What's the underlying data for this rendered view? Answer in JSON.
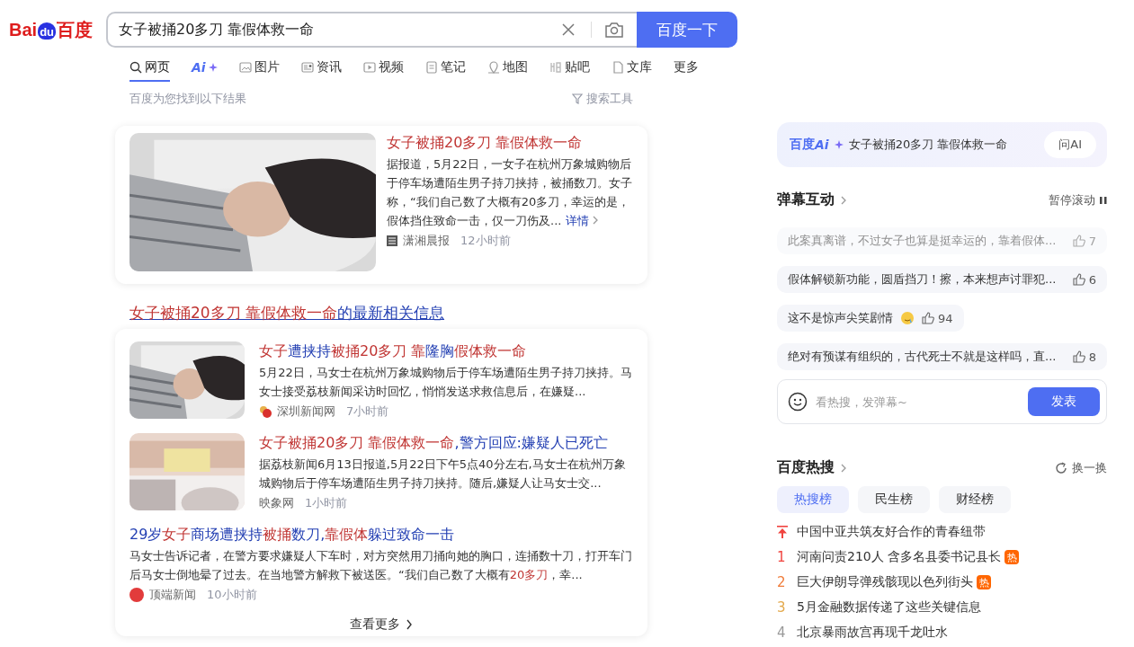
{
  "logo": {
    "text_1": "Bai",
    "text_2": "du",
    "text_3": "百度"
  },
  "search": {
    "value": "女子被捅20多刀 靠假体救一命",
    "button": "百度一下"
  },
  "tabs": [
    {
      "label": "网页",
      "selected": true
    },
    {
      "label": "Ai",
      "selected": false
    },
    {
      "label": "图片",
      "selected": false
    },
    {
      "label": "资讯",
      "selected": false
    },
    {
      "label": "视频",
      "selected": false
    },
    {
      "label": "笔记",
      "selected": false
    },
    {
      "label": "地图",
      "selected": false
    },
    {
      "label": "贴吧",
      "selected": false
    },
    {
      "label": "文库",
      "selected": false
    },
    {
      "label": "更多",
      "selected": false
    }
  ],
  "results_summary": "百度为您找到以下结果",
  "search_tools": "搜索工具",
  "top_result": {
    "title": "女子被捅20多刀 靠假体救一命",
    "snippet": "据报道，5月22日，一女子在杭州万象城购物后于停车场遭陌生男子持刀挟持，被捅数刀。女子称，“我们自己数了大概有20多刀，幸运的是，假体挡住致命一击，仅一刀伤及...",
    "more": "详情",
    "source": "潇湘晨报",
    "time": "12小时前"
  },
  "news_header": [
    {
      "text": "女子被捅20多刀 靠假体救一命",
      "highlight": true
    },
    {
      "text": "的最新相关信息",
      "highlight": false
    }
  ],
  "news": [
    {
      "kind": "picture",
      "title": [
        {
          "text": "女子",
          "highlight": true
        },
        {
          "text": "遭挟持",
          "highlight": false
        },
        {
          "text": "被捅20多刀 靠",
          "highlight": true
        },
        {
          "text": "隆胸",
          "highlight": false
        },
        {
          "text": "假体救一命",
          "highlight": true
        }
      ],
      "snippet": [
        {
          "text": "5月22日，马女士在杭州万象城购物后于停车场遭陌生男子持刀挟持。马女士接受荔枝新闻采访时回忆，悄悄发送求救信息后，在嫌疑...",
          "highlight": false
        }
      ],
      "source": "深圳新闻网",
      "time": "7小时前"
    },
    {
      "kind": "picture",
      "title": [
        {
          "text": "女子被捅20多刀 靠假体救一命",
          "highlight": true
        },
        {
          "text": ",警方回应:嫌疑人已死亡",
          "highlight": false
        }
      ],
      "snippet": [
        {
          "text": "据荔枝新闻6月13日报道,5月22日下午5点40分左右,马女士在杭州万象城购物后于停车场遭陌生男子持刀挟持。随后,嫌疑人让马女士交...",
          "highlight": false
        }
      ],
      "source": "映象网",
      "time": "1小时前"
    },
    {
      "kind": "text",
      "title": [
        {
          "text": "29岁",
          "highlight": false
        },
        {
          "text": "女子",
          "highlight": true
        },
        {
          "text": "商场遭挟持",
          "highlight": false
        },
        {
          "text": "被捅",
          "highlight": true
        },
        {
          "text": "数刀,",
          "highlight": false
        },
        {
          "text": "靠假体",
          "highlight": true
        },
        {
          "text": "躲过致命一击",
          "highlight": false
        }
      ],
      "snippet": [
        {
          "text": "马女士告诉记者，在警方要求嫌疑人下车时，对方突然用刀捅向她的胸口，连捅数十刀，打开车门后马女士倒地晕了过去。在当地警方解救下被送医。“我们自己数了大概有",
          "highlight": false
        },
        {
          "text": "20多刀",
          "highlight": true
        },
        {
          "text": "，幸...",
          "highlight": false
        }
      ],
      "source": "顶端新闻",
      "time": "10小时前"
    }
  ],
  "see_more": "查看更多",
  "ai_card": {
    "brand": "百度",
    "brand_ai": "Ai",
    "query": "女子被捅20多刀 靠假体救一命",
    "button": "问AI"
  },
  "danmaku": {
    "title": "弹幕互动",
    "pause": "暂停滚动",
    "comments": [
      {
        "text": "此案真离谱，不过女子也算是挺幸运的，靠着假体...",
        "likes": "7",
        "faded": true,
        "emoji": false
      },
      {
        "text": "假体解锁新功能，圆盾挡刀！擦，本来想声讨罪犯...",
        "likes": "6",
        "faded": false,
        "emoji": false
      },
      {
        "text": "这不是惊声尖笑剧情",
        "likes": "94",
        "faded": false,
        "emoji": true
      },
      {
        "text": "绝对有预谋有组织的，古代死士不就是这样吗，直...",
        "likes": "8",
        "faded": false,
        "emoji": false
      }
    ],
    "placeholder": "看热搜，发弹幕~",
    "send": "发表"
  },
  "hot": {
    "title": "百度热搜",
    "refresh": "换一换",
    "tabs": [
      {
        "label": "热搜榜",
        "selected": true
      },
      {
        "label": "民生榜",
        "selected": false
      },
      {
        "label": "财经榜",
        "selected": false
      }
    ],
    "items": [
      {
        "kind": "pinned",
        "text": "中国中亚共筑友好合作的青春纽带",
        "color": "#f0443f"
      },
      {
        "kind": "ranked",
        "rank": "1",
        "text": "河南问责210人 含多名县委书记县长",
        "color": "#f0443f",
        "badge": "热"
      },
      {
        "kind": "ranked",
        "rank": "2",
        "text": "巨大伊朗导弹残骸现以色列街头",
        "color": "#f07c3a",
        "badge": "热"
      },
      {
        "kind": "ranked",
        "rank": "3",
        "text": "5月金融数据传递了这些关键信息",
        "color": "#e3a84a"
      },
      {
        "kind": "ranked",
        "rank": "4",
        "text": "北京暴雨故宫再现千龙吐水",
        "color": "#999999"
      }
    ]
  }
}
